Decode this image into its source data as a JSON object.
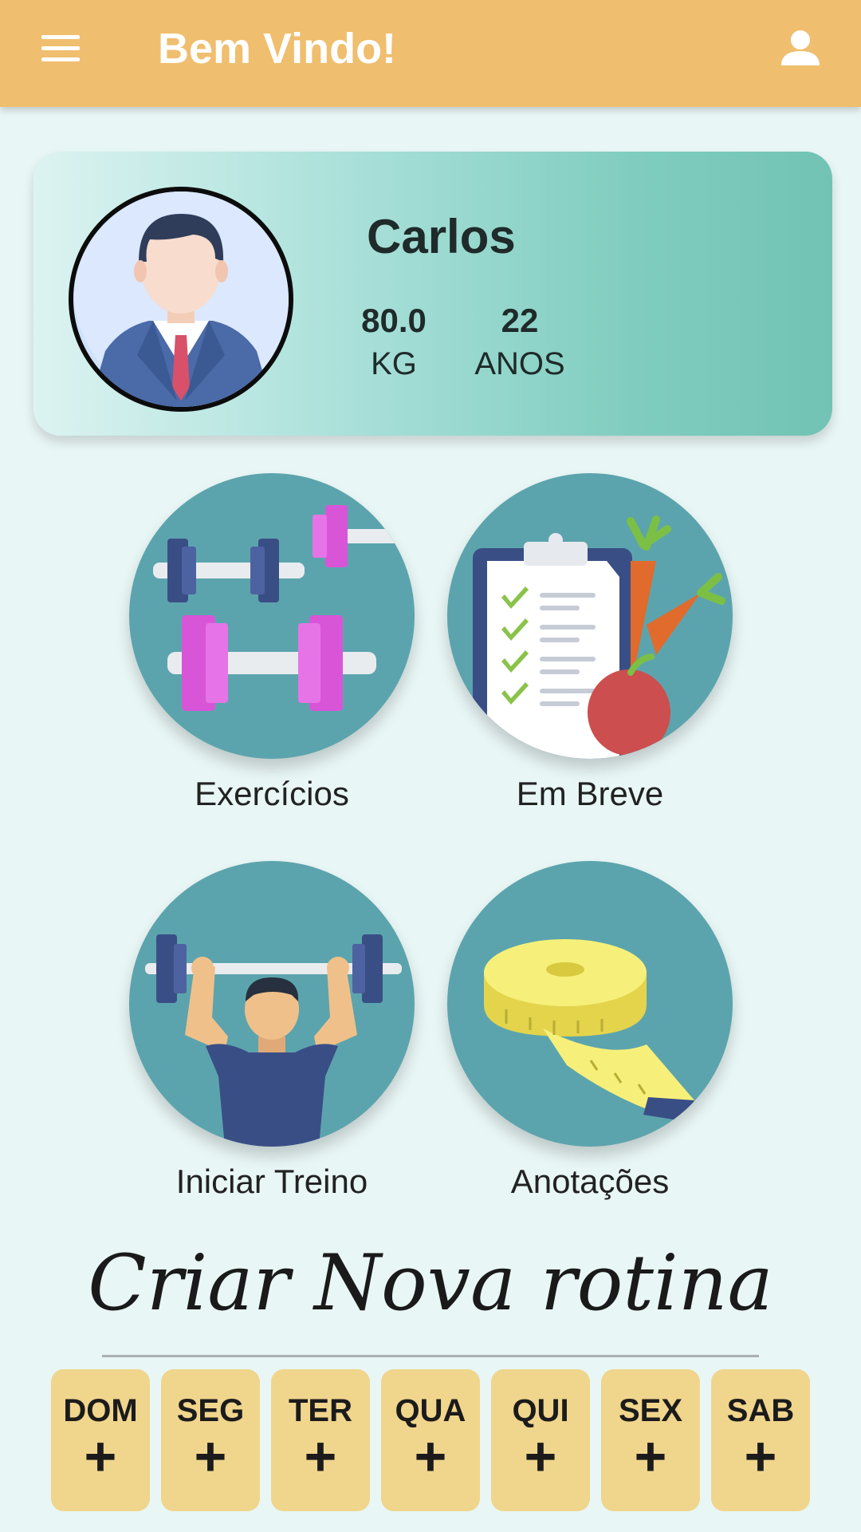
{
  "appbar": {
    "title": "Bem Vindo!"
  },
  "profile": {
    "name": "Carlos",
    "weight_value": "80.0",
    "weight_unit": "KG",
    "age_value": "22",
    "age_unit": "ANOS"
  },
  "tiles": [
    {
      "label": "Exercícios"
    },
    {
      "label": "Em Breve"
    },
    {
      "label": "Iniciar Treino"
    },
    {
      "label": "Anotações"
    }
  ],
  "routine": {
    "title": "Criar Nova rotina",
    "days": [
      {
        "label": "DOM",
        "icon": "+"
      },
      {
        "label": "SEG",
        "icon": "+"
      },
      {
        "label": "TER",
        "icon": "+"
      },
      {
        "label": "QUA",
        "icon": "+"
      },
      {
        "label": "QUI",
        "icon": "+"
      },
      {
        "label": "SEX",
        "icon": "+"
      },
      {
        "label": "SAB",
        "icon": "+"
      }
    ]
  },
  "colors": {
    "appbar": "#efbe6e",
    "background": "#e8f6f5",
    "tile_circle": "#5ca4ad",
    "day_button": "#f0d58c"
  }
}
